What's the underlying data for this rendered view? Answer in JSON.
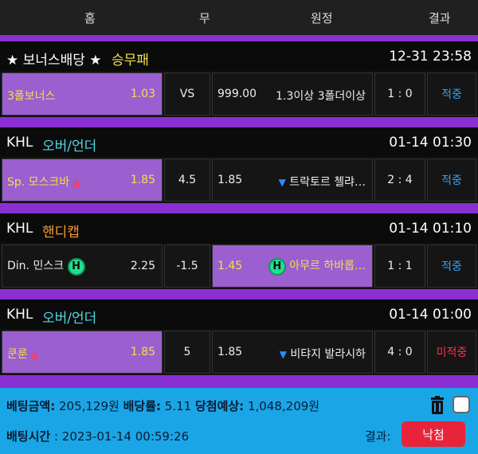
{
  "header": {
    "home": "홈",
    "draw": "무",
    "away": "원정",
    "result": "결과"
  },
  "games": [
    {
      "league": "★ 보너스배당 ★",
      "type": "승무패",
      "time": "12-31 23:58",
      "home_team": "3폴보너스",
      "home_odds": "1.03",
      "middle": "VS",
      "away_odds": "999.00",
      "away_team": "1.3이상 3폴더이상",
      "score": "1 : 0",
      "status": "적중"
    },
    {
      "league": "KHL",
      "type": "오버/언더",
      "time": "01-14 01:30",
      "home_team": "Sp. 모스크바",
      "home_odds": "1.85",
      "middle": "4.5",
      "away_odds": "1.85",
      "away_team": "트락토르 첼랴…",
      "score": "2 : 4",
      "status": "적중"
    },
    {
      "league": "KHL",
      "type": "핸디캡",
      "time": "01-14 01:10",
      "home_team": "Din. 민스크",
      "home_badge": "H",
      "home_odds": "2.25",
      "middle": "-1.5",
      "away_odds": "1.45",
      "away_badge": "H",
      "away_team": "아무르 하바롭…",
      "score": "1 : 1",
      "status": "적중"
    },
    {
      "league": "KHL",
      "type": "오버/언더",
      "time": "01-14 01:00",
      "home_team": "쿤룬",
      "home_odds": "1.85",
      "middle": "5",
      "away_odds": "1.85",
      "away_team": "비탸지 발라시하",
      "score": "4 : 0",
      "status": "미적중"
    }
  ],
  "footer": {
    "bet_amount_label": "베팅금액:",
    "bet_amount": "205,129원",
    "odds_label": "배당률:",
    "odds": "5.11",
    "expected_label": "당첨예상:",
    "expected": "1,048,209원",
    "bet_time_label": "배팅시간",
    "bet_time": ": 2023-01-14 00:59:26",
    "result_label": "결과:",
    "result_button": "낙첨"
  },
  "colors": {
    "background": "#8a2fd1",
    "highlight_cell": "#9b5fcf",
    "win": "#2ea4ff",
    "lose": "#ff2f45",
    "footer": "#1aa6e6"
  }
}
